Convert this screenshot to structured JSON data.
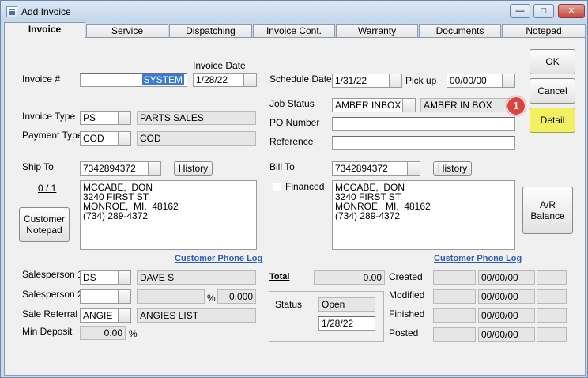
{
  "window": {
    "title": "Add Invoice",
    "min_symbol": "—",
    "max_symbol": "□",
    "close_symbol": "✕"
  },
  "tabs": [
    {
      "label": "Invoice"
    },
    {
      "label": "Service"
    },
    {
      "label": "Dispatching"
    },
    {
      "label": "Invoice Cont."
    },
    {
      "label": "Warranty"
    },
    {
      "label": "Documents"
    },
    {
      "label": "Notepad"
    }
  ],
  "left": {
    "invoice_no_label": "Invoice #",
    "invoice_no_value": "SYSTEM",
    "invoice_date_label": "Invoice Date",
    "invoice_date_value": "1/28/22",
    "invoice_type_label": "Invoice Type",
    "invoice_type_value": "PS",
    "invoice_type_desc": "PARTS SALES",
    "payment_type_label": "Payment Type",
    "payment_type_value": "COD",
    "payment_type_desc": "COD",
    "ship_to_label": "Ship To",
    "ship_to_value": "7342894372",
    "history_label": "History",
    "counter": "0 / 1",
    "customer_notepad_label": "Customer\nNotepad",
    "ship_address": "MCCABE,  DON\n3240 FIRST ST.\nMONROE,  MI,  48162\n(734) 289-4372",
    "customer_phone_log": "Customer Phone Log",
    "salesperson1_label": "Salesperson 1",
    "salesperson1_value": "DS",
    "salesperson1_desc": "DAVE S",
    "salesperson2_label": "Salesperson 2",
    "salesperson2_value": "",
    "salesperson2_desc": "",
    "percent_sign": "%",
    "salesperson2_pct": "0.000",
    "sale_referral_label": "Sale Referral",
    "sale_referral_value": "ANGIE",
    "sale_referral_desc": "ANGIES LIST",
    "min_deposit_label": "Min Deposit",
    "min_deposit_value": "0.00"
  },
  "middle": {
    "schedule_date_label": "Schedule Date",
    "schedule_date_value": "1/31/22",
    "pickup_label": "Pick up",
    "pickup_value": "00/00/00",
    "job_status_label": "Job Status",
    "job_status_value": "AMBER INBOX",
    "job_status_desc": "AMBER IN BOX",
    "po_number_label": "PO Number",
    "po_number_value": "",
    "reference_label": "Reference",
    "reference_value": "",
    "bill_to_label": "Bill To",
    "bill_to_value": "7342894372",
    "history_label": "History",
    "financed_label": "Financed",
    "bill_address": "MCCABE,  DON\n3240 FIRST ST.\nMONROE,  MI,  48162\n(734) 289-4372",
    "customer_phone_log": "Customer Phone Log",
    "total_label": "Total",
    "total_value": "0.00",
    "status_label": "Status",
    "status_value": "Open",
    "status_date": "1/28/22",
    "created_label": "Created",
    "modified_label": "Modified",
    "finished_label": "Finished",
    "posted_label": "Posted",
    "created_date": "00/00/00",
    "modified_date": "00/00/00",
    "finished_date": "00/00/00",
    "posted_date": "00/00/00"
  },
  "buttons": {
    "ok": "OK",
    "cancel": "Cancel",
    "detail": "Detail",
    "ar_balance": "A/R\nBalance"
  },
  "annotation": {
    "badge": "1"
  },
  "colors": {
    "detail_bg": "#f2f062",
    "badge": "#e0433b",
    "link": "#2c5eb8"
  }
}
